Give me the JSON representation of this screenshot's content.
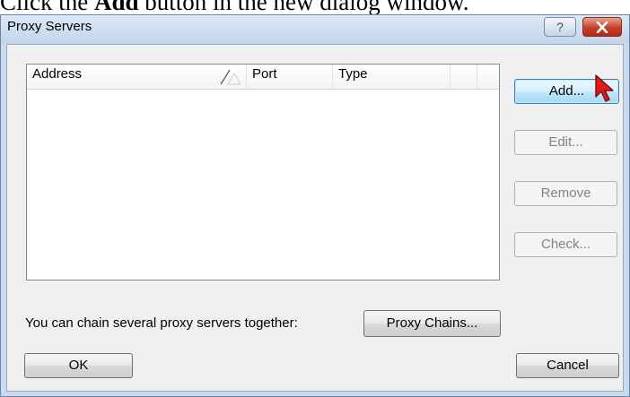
{
  "instruction": {
    "prefix": "Click the ",
    "emphasis": "Add",
    "suffix": " button in the new dialog window."
  },
  "dialog": {
    "title": "Proxy Servers",
    "help_glyph": "?",
    "columns": [
      "Address",
      "Port",
      "Type"
    ],
    "rows": [],
    "side_buttons": {
      "add": "Add...",
      "edit": "Edit...",
      "remove": "Remove",
      "check": "Check..."
    },
    "chain_hint": "You can chain several proxy servers together:",
    "proxy_chains_button": "Proxy Chains...",
    "ok_button": "OK",
    "cancel_button": "Cancel"
  },
  "icons": {
    "help": "question-mark-icon",
    "close": "close-x-icon",
    "cursor": "red-arrow-cursor-icon"
  },
  "colors": {
    "title_frame": "#c9daee",
    "client_bg": "#f0f0f0",
    "close_red": "#c4412b",
    "default_button_border": "#3c7fb1",
    "cursor_red": "#e01b1b"
  }
}
